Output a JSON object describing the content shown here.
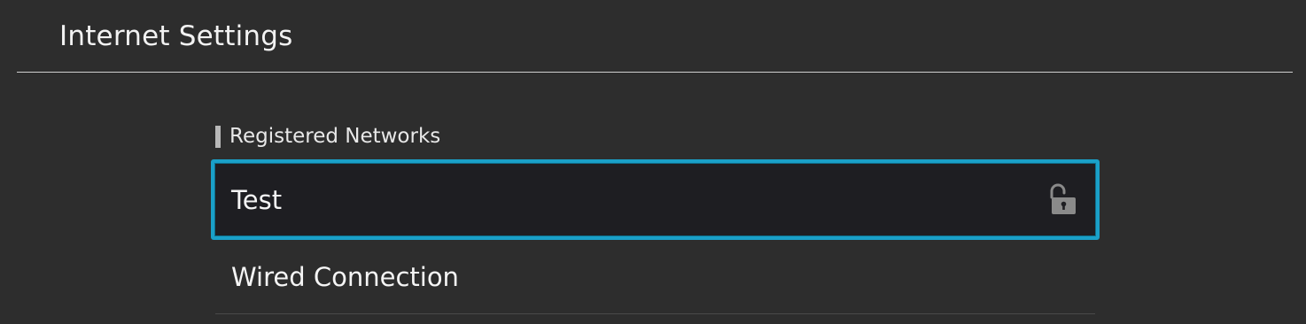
{
  "header": {
    "title": "Internet Settings"
  },
  "registered_networks": {
    "heading": "Registered Networks",
    "items": [
      {
        "label": "Test",
        "selected": true,
        "icon": "open-lock-icon"
      },
      {
        "label": "Wired Connection",
        "selected": false,
        "icon": ""
      }
    ]
  },
  "colors": {
    "background": "#2d2d2d",
    "selection_border": "#1aa0c8",
    "selected_row_background": "#1e1e22",
    "divider": "#cfcfcf",
    "icon": "#8a8a8a"
  }
}
